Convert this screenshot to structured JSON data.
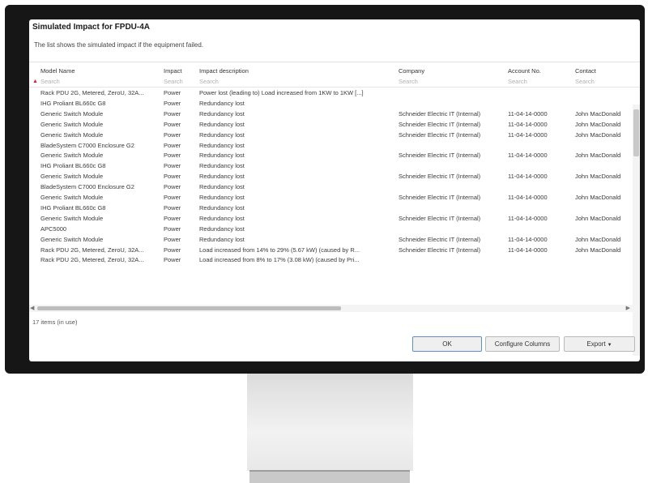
{
  "dialog": {
    "title": "Simulated Impact for FPDU-4A",
    "description": "The list shows the simulated impact if the equipment failed."
  },
  "columns": [
    "Model Name",
    "Impact",
    "Impact description",
    "Company",
    "Account No.",
    "Contact"
  ],
  "filter_placeholder": "Search",
  "rows": [
    [
      "Rack PDU 2G, Metered, ZeroU, 32A...",
      "Power",
      "Power lost (leading to) Load increased from 1KW to 1KW [...]",
      "",
      "",
      ""
    ],
    [
      "IHG Proliant BL660c G8",
      "Power",
      "Redundancy lost",
      "",
      "",
      ""
    ],
    [
      "Generic Switch Module",
      "Power",
      "Redundancy lost",
      "Schneider Electric IT (Internal)",
      "11-04-14-0000",
      "John MacDonald"
    ],
    [
      "Generic Switch Module",
      "Power",
      "Redundancy lost",
      "Schneider Electric IT (Internal)",
      "11-04-14-0000",
      "John MacDonald"
    ],
    [
      "Generic Switch Module",
      "Power",
      "Redundancy lost",
      "Schneider Electric IT (Internal)",
      "11-04-14-0000",
      "John MacDonald"
    ],
    [
      "BladeSystem C7000 Enclosure G2",
      "Power",
      "Redundancy lost",
      "",
      "",
      ""
    ],
    [
      "Generic Switch Module",
      "Power",
      "Redundancy lost",
      "Schneider Electric IT (Internal)",
      "11-04-14-0000",
      "John MacDonald"
    ],
    [
      "IHG Proliant BL660c G8",
      "Power",
      "Redundancy lost",
      "",
      "",
      ""
    ],
    [
      "Generic Switch Module",
      "Power",
      "Redundancy lost",
      "Schneider Electric IT (Internal)",
      "11-04-14-0000",
      "John MacDonald"
    ],
    [
      "BladeSystem C7000 Enclosure G2",
      "Power",
      "Redundancy lost",
      "",
      "",
      ""
    ],
    [
      "Generic Switch Module",
      "Power",
      "Redundancy lost",
      "Schneider Electric IT (Internal)",
      "11-04-14-0000",
      "John MacDonald"
    ],
    [
      "IHG Proliant BL660c G8",
      "Power",
      "Redundancy lost",
      "",
      "",
      ""
    ],
    [
      "Generic Switch Module",
      "Power",
      "Redundancy lost",
      "Schneider Electric IT (Internal)",
      "11-04-14-0000",
      "John MacDonald"
    ],
    [
      "APC5000",
      "Power",
      "Redundancy lost",
      "",
      "",
      ""
    ],
    [
      "Generic Switch Module",
      "Power",
      "Redundancy lost",
      "Schneider Electric IT (Internal)",
      "11-04-14-0000",
      "John MacDonald"
    ],
    [
      "Rack PDU 2G, Metered, ZeroU, 32A...",
      "Power",
      "Load increased from 14% to 29% (5.67 kW) (caused by R...",
      "Schneider Electric IT (Internal)",
      "11-04-14-0000",
      "John MacDonald"
    ],
    [
      "Rack PDU 2G, Metered, ZeroU, 32A...",
      "Power",
      "Load increased from 8% to 17% (3.08 kW) (caused by Pri...",
      "",
      "",
      ""
    ]
  ],
  "items_count": "17 items (in use)",
  "buttons": {
    "ok": "OK",
    "configure": "Configure Columns",
    "export": "Export"
  }
}
